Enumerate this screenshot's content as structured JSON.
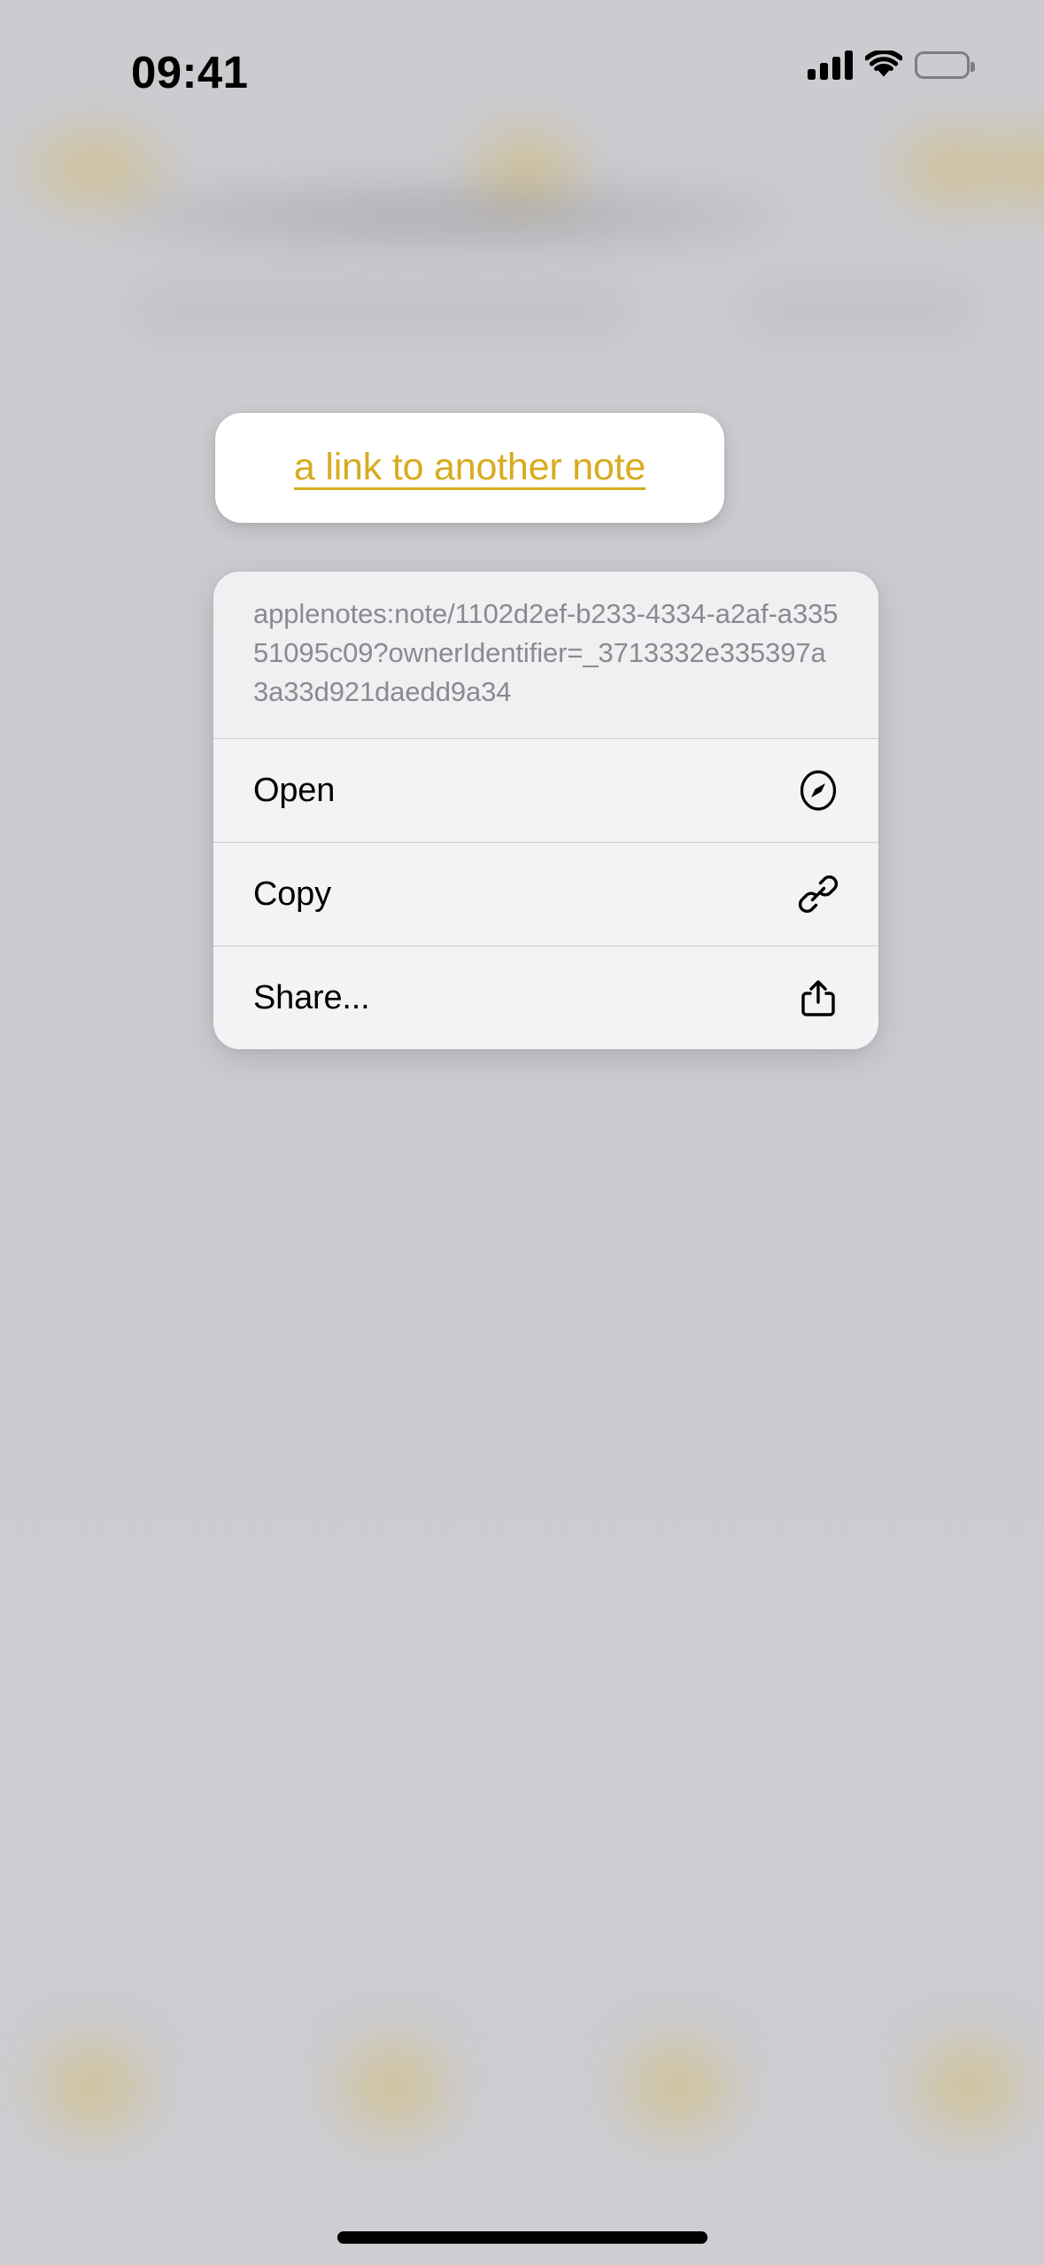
{
  "status_bar": {
    "time": "09:41",
    "cellular_icon": "cellular-bars-icon",
    "cellular_bars": 4,
    "wifi_icon": "wifi-icon",
    "battery_icon": "battery-full-icon",
    "battery_level": 100
  },
  "link_bubble": {
    "link_text": "a link to another note",
    "link_color": "#d8ab1f"
  },
  "context_menu": {
    "url_preview": "applenotes:note/1102d2ef-b233-4334-a2af-a33551095c09?ownerIdentifier=_3713332e335397a3a33d921daedd9a34",
    "actions": [
      {
        "label": "Open",
        "icon": "safari-compass-icon"
      },
      {
        "label": "Copy",
        "icon": "link-chain-icon"
      },
      {
        "label": "Share...",
        "icon": "share-square-up-arrow-icon"
      }
    ]
  },
  "home_indicator": {
    "name": "home-indicator"
  }
}
